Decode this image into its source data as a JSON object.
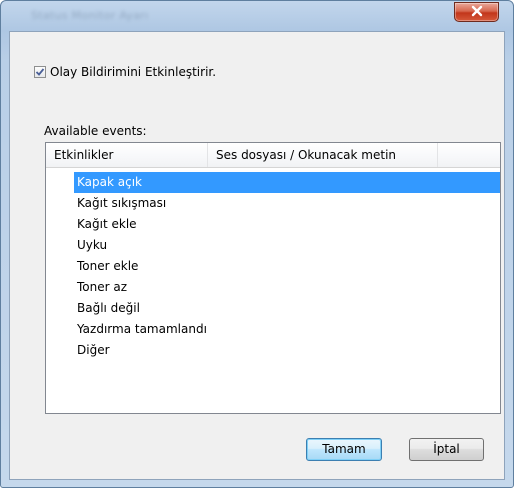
{
  "window": {
    "title": "Status Monitor Ayarı",
    "close_glyph": "✕"
  },
  "notification": {
    "checkbox_label": "Olay Bildirimini Etkinleştirir.",
    "checked": true
  },
  "events": {
    "label": "Available events:",
    "columns": [
      "Etkinlikler",
      "Ses dosyası / Okunacak metin"
    ],
    "items": [
      {
        "label": "Kapak açık",
        "selected": true
      },
      {
        "label": "Kağıt sıkışması"
      },
      {
        "label": "Kağıt ekle"
      },
      {
        "label": "Uyku"
      },
      {
        "label": "Toner ekle"
      },
      {
        "label": "Toner az"
      },
      {
        "label": "Bağlı değil"
      },
      {
        "label": "Yazdırma tamamlandı"
      },
      {
        "label": "Diğer"
      }
    ]
  },
  "buttons": {
    "ok": "Tamam",
    "cancel": "İptal"
  },
  "colors": {
    "selection": "#3399ff",
    "close_red": "#c2361b"
  }
}
